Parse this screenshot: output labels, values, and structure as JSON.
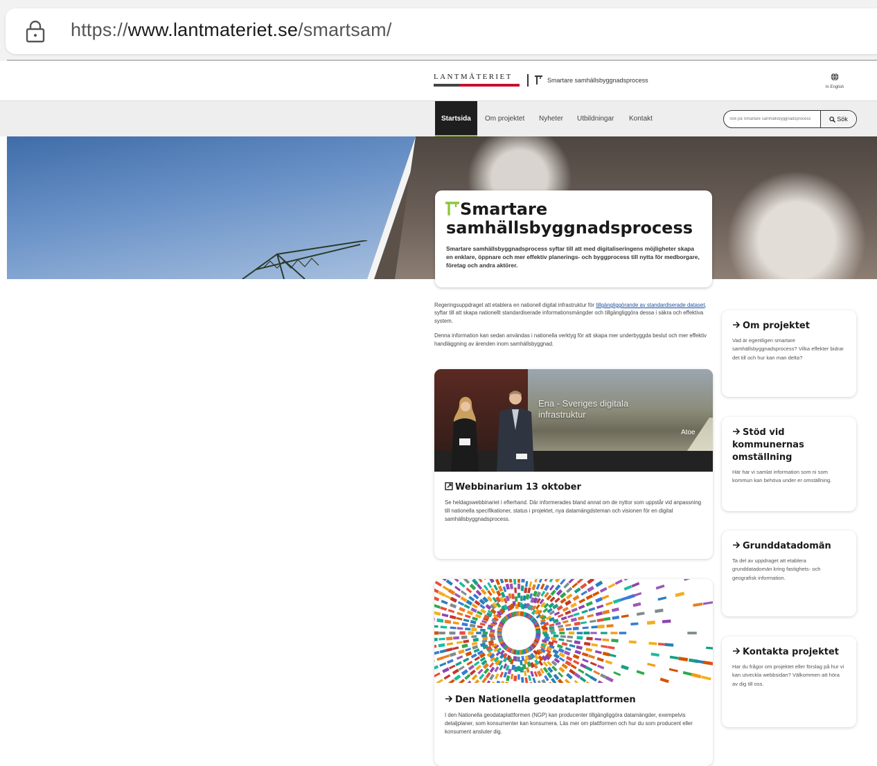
{
  "browser": {
    "url_prefix": "https://",
    "url_domain": "www.lantmateriet.se",
    "url_path": "/smartsam/"
  },
  "header": {
    "logo_text": "LANTMÄTERIET",
    "subbrand": "Smartare samhällsbyggnadsprocess",
    "lang_label": "In English"
  },
  "nav": {
    "items": [
      "Startsida",
      "Om projektet",
      "Nyheter",
      "Utbildningar",
      "Kontakt"
    ],
    "active": "Startsida",
    "search_placeholder": "Sök på Smartare samhällsbyggnadsprocess",
    "search_button": "Sök"
  },
  "hero": {
    "title": "Smartare samhällsbyggnadsprocess",
    "description": "Smartare samhällsbyggnadsprocess syftar till att med digitaliseringens möjligheter skapa en enklare, öppnare och mer effektiv planerings- och byggprocess till nytta för medborgare, företag och andra aktörer."
  },
  "intro": {
    "p1_before": "Regeringsuppdraget att etablera en nationell digital infrastruktur för ",
    "p1_link": "tillgängliggörande av standardiserade dataset",
    "p1_after": ", syftar till att skapa nationellt standardiserade informationsmängder och tillgängliggöra dessa i säkra och effektiva system.",
    "p2": "Denna information kan sedan användas i nationella verktyg för att skapa mer underbyggda beslut och mer effektiv handläggning av ärenden inom samhällsbyggnad."
  },
  "cards": [
    {
      "video_caption_1": "Ena - Sveriges digitala",
      "video_caption_2": "infrastruktur",
      "video_logo": "Atoe",
      "title": "Webbinarium 13 oktober",
      "text": "Se heldagswebbinariet i efterhand. Där informerades bland annat om de nyttor som uppstår vid anpassning till nationella specifikationer, status i projektet, nya datamängdsteman och visionen för en digital samhällsbyggnadsprocess."
    },
    {
      "title": "Den Nationella geodataplattformen",
      "text": "I den Nationella geodataplattformen (NGP) kan producenter tillgängliggöra datamängder, exempelvis detaljplaner, som konsumenter kan konsumera. Läs mer om plattformen och hur du som producent eller konsument ansluter dig."
    }
  ],
  "side": [
    {
      "title": "Om projektet",
      "text": "Vad är egentligen smartare samhällsbyggnadsprocess? Vilka effekter bidrar det till och hur kan man delta?"
    },
    {
      "title": "Stöd vid kommunernas omställning",
      "text": "Här har vi samlat information som ni som kommun kan behöva under er omställning."
    },
    {
      "title": "Grunddatadomän",
      "text": "Ta del av uppdraget att etablera grunddatadomän kring fastighets- och geografisk information."
    },
    {
      "title": "Kontakta projektet",
      "text": "Har du frågor om projektet eller förslag på hur vi kan utveckla webbsidan? Välkommen att höra av dig till oss."
    }
  ],
  "colors": {
    "accent_green": "#8dc63f",
    "nav_active_bg": "#1e1e1e",
    "link_blue": "#1f4fa0",
    "logo_red": "#c8102e"
  },
  "icons": {
    "url": "lock-icon",
    "lang": "globe-icon",
    "search": "search-icon",
    "brand": "smartsam-t-icon",
    "arrow": "arrow-right-icon",
    "external": "external-link-icon"
  }
}
